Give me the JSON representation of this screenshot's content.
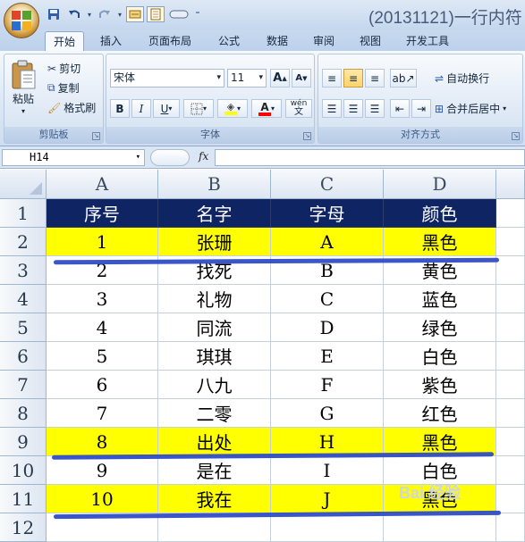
{
  "window": {
    "title": "(20131121)一行内符"
  },
  "quick_access": {
    "icons": [
      "save-icon",
      "undo-icon",
      "redo-icon",
      "form-icon",
      "layout-icon",
      "shape-icon",
      "customize-icon"
    ]
  },
  "tabs": [
    {
      "label": "开始",
      "active": true
    },
    {
      "label": "插入"
    },
    {
      "label": "页面布局"
    },
    {
      "label": "公式"
    },
    {
      "label": "数据"
    },
    {
      "label": "审阅"
    },
    {
      "label": "视图"
    },
    {
      "label": "开发工具"
    }
  ],
  "clipboard": {
    "paste": "粘贴",
    "cut": "剪切",
    "copy": "复制",
    "format_painter": "格式刷",
    "label": "剪贴板"
  },
  "font": {
    "name": "宋体",
    "size": "11",
    "grow": "A",
    "shrink": "A",
    "bold": "B",
    "italic": "I",
    "underline": "U",
    "phonetic": "wén",
    "label": "字体",
    "fill_color": "#ffff00",
    "font_color": "#ff0000"
  },
  "alignment": {
    "wrap": "自动换行",
    "merge": "合并后居中",
    "label": "对齐方式"
  },
  "formula_bar": {
    "cell": "H14",
    "fx": "fx",
    "value": ""
  },
  "sheet": {
    "columns": [
      "A",
      "B",
      "C",
      "D"
    ],
    "rows": [
      "1",
      "2",
      "3",
      "4",
      "5",
      "6",
      "7",
      "8",
      "9",
      "10",
      "11",
      "12"
    ],
    "header": [
      "序号",
      "名字",
      "字母",
      "颜色"
    ],
    "data": [
      [
        "1",
        "张珊",
        "A",
        "黑色"
      ],
      [
        "2",
        "找死",
        "B",
        "黄色"
      ],
      [
        "3",
        "礼物",
        "C",
        "蓝色"
      ],
      [
        "4",
        "同流",
        "D",
        "绿色"
      ],
      [
        "5",
        "琪琪",
        "E",
        "白色"
      ],
      [
        "6",
        "八九",
        "F",
        "紫色"
      ],
      [
        "7",
        "二零",
        "G",
        "红色"
      ],
      [
        "8",
        "出处",
        "H",
        "黑色"
      ],
      [
        "9",
        "是在",
        "I",
        "白色"
      ],
      [
        "10",
        "我在",
        "J",
        "黑色"
      ]
    ],
    "highlight_color": "#ffff00",
    "header_fill": "#0f2463"
  },
  "watermark": "Bai 经验"
}
